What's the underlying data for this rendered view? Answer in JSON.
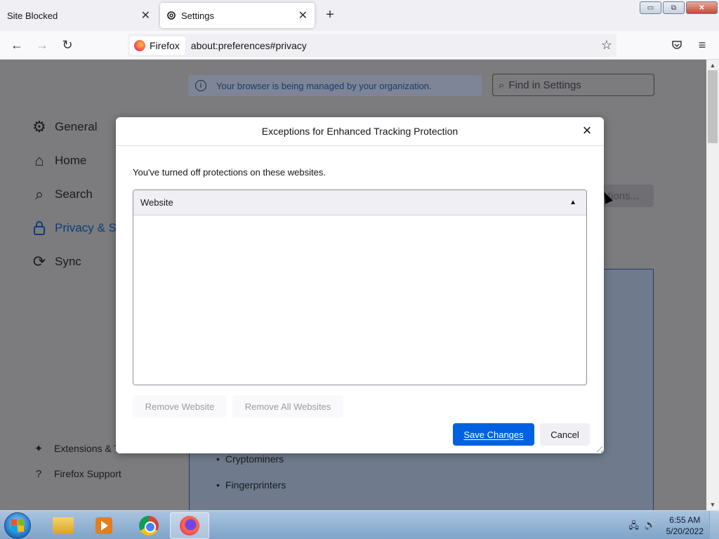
{
  "tabs": [
    {
      "label": "Site Blocked"
    },
    {
      "label": "Settings"
    }
  ],
  "window_controls": {
    "minimize": "▭",
    "restore": "⧉",
    "close": "✕"
  },
  "navbar": {
    "identity_label": "Firefox",
    "url": "about:preferences#privacy"
  },
  "page": {
    "managed_notice": "Your browser is being managed by your organization.",
    "find_placeholder": "Find in Settings",
    "sidebar": [
      {
        "label": "General",
        "icon": "gear-icon"
      },
      {
        "label": "Home",
        "icon": "home-icon"
      },
      {
        "label": "Search",
        "icon": "search-icon"
      },
      {
        "label": "Privacy & Se",
        "icon": "lock-icon"
      },
      {
        "label": "Sync",
        "icon": "sync-icon"
      }
    ],
    "sidebar_bottom": [
      {
        "label": "Extensions & T",
        "icon": "puzzle-icon"
      },
      {
        "label": "Firefox Support",
        "icon": "help-icon"
      }
    ],
    "exceptions_button": "tions...",
    "bullets": [
      "Cryptominers",
      "Fingerprinters"
    ]
  },
  "dialog": {
    "title": "Exceptions for Enhanced Tracking Protection",
    "description": "You've turned off protections on these websites.",
    "column_header": "Website",
    "remove_website": "Remove Website",
    "remove_all": "Remove All Websites",
    "save": "Save Changes",
    "cancel": "Cancel"
  },
  "taskbar": {
    "time": "6:55 AM",
    "date": "5/20/2022"
  },
  "colors": {
    "primary_button": "#0061e0",
    "active_sidebar": "#0b3c7e"
  }
}
